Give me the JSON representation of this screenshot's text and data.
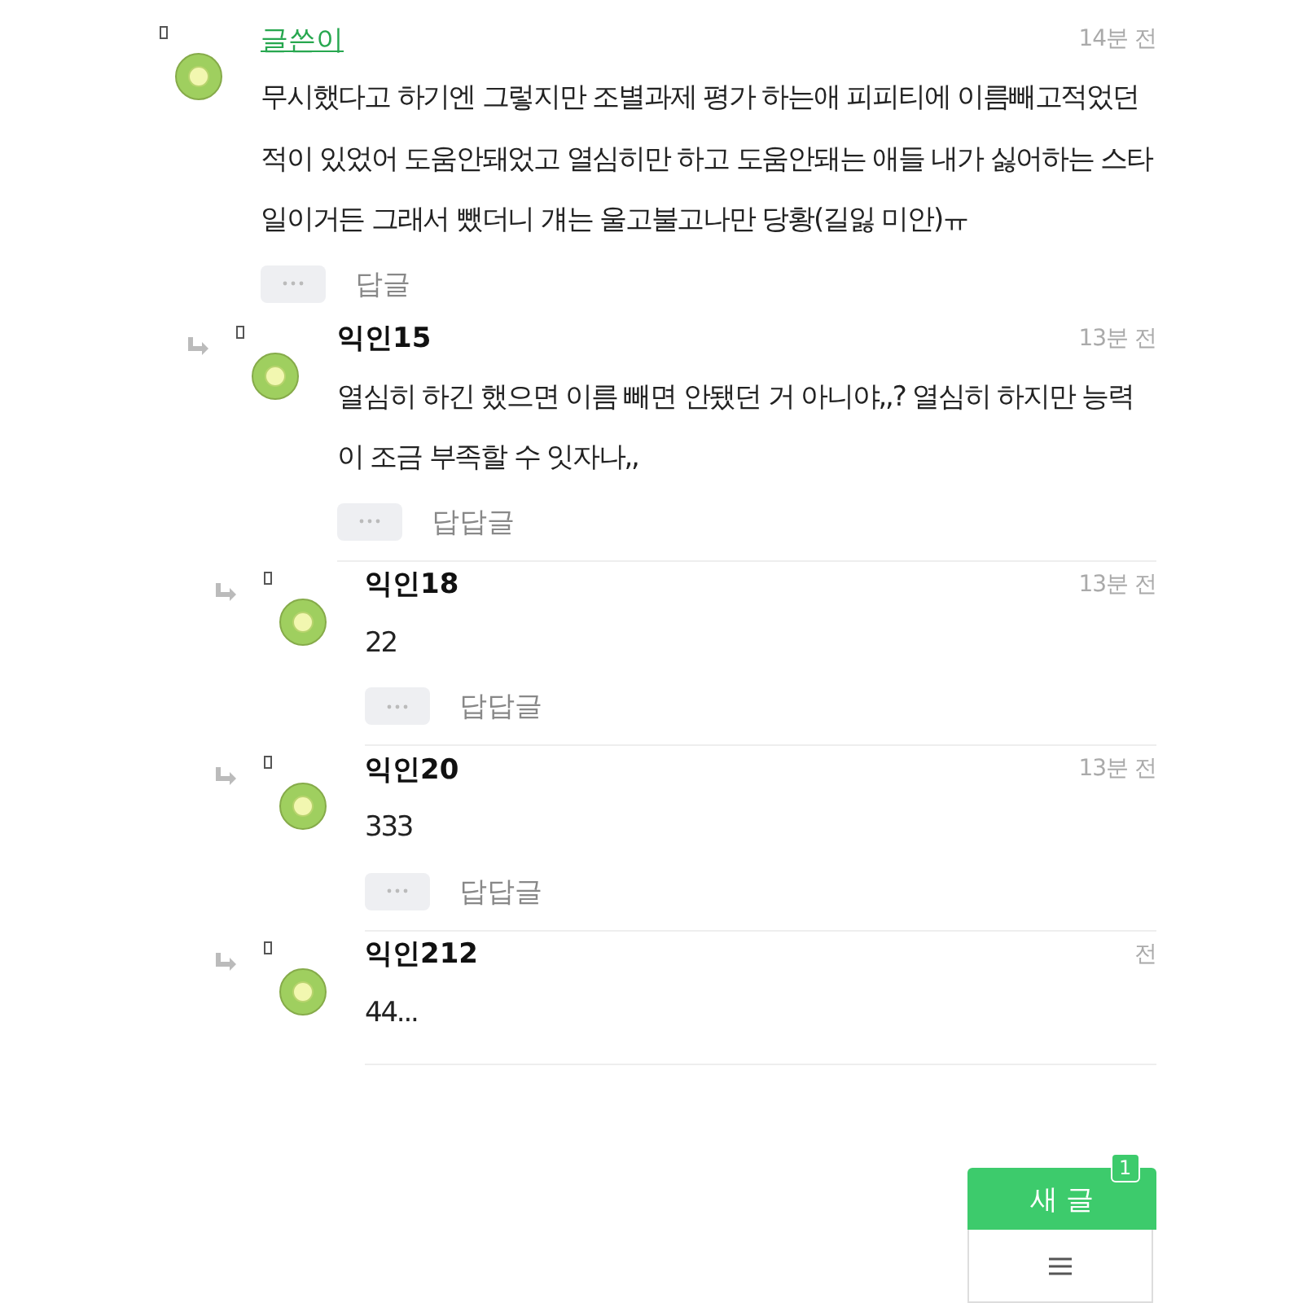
{
  "comments": [
    {
      "author": "글쓴이",
      "is_writer": true,
      "time": "14분 전",
      "text": "무시했다고 하기엔 그렇지만 조별과제 평가 하는애 피피티에 이름빼고적었던 적이 있었어 도움안돼었고 열심히만 하고 도움안돼는 애들 내가 싫어하는 스타일이거든 그래서 뺐더니 걔는 울고불고나만 당황(길잃 미안)ㅠ",
      "reply_label": "답글",
      "children": [
        {
          "author": "익인15",
          "is_writer": false,
          "time": "13분 전",
          "text": "열심히 하긴 했으면 이름 빼면 안됐던 거 아니야,,? 열심히 하지만 능력이 조금 부족할 수 잇자나,,",
          "reply_label": "답답글",
          "children": [
            {
              "author": "익인18",
              "is_writer": false,
              "time": "13분 전",
              "text": "22",
              "reply_label": "답답글"
            },
            {
              "author": "익인20",
              "is_writer": false,
              "time": "13분 전",
              "text": "333",
              "reply_label": "답답글"
            },
            {
              "author": "익인212",
              "is_writer": false,
              "time": "전",
              "text": "44..."
            }
          ]
        }
      ]
    }
  ],
  "floating_button": {
    "label": "새 글",
    "badge": "1"
  }
}
